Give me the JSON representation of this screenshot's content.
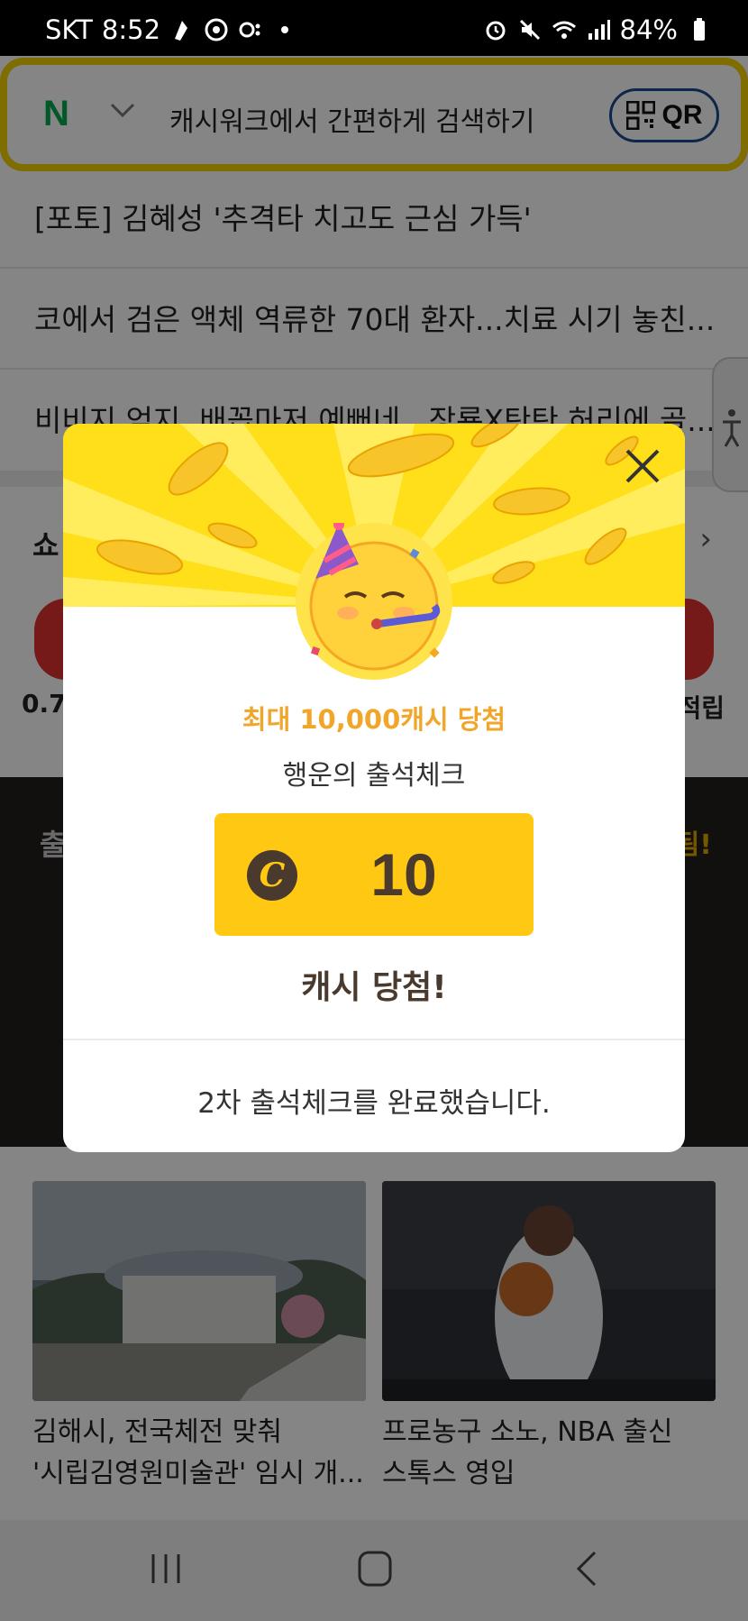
{
  "status_bar": {
    "carrier": "SKT",
    "time": "8:52",
    "battery": "84%"
  },
  "search": {
    "engine_logo": "N",
    "placeholder": "캐시워크에서 간편하게 검색하기",
    "qr_label": "QR"
  },
  "news": [
    "[포토] 김혜성 '추격타 치고도 근심 가득'",
    "코에서 검은 액체 역류한 70대 환자...치료 시기 놓친...",
    "비비지 엄지, 배꼽마저 예뻐네.. 장룡X탄탄 허리에 골..."
  ],
  "shopping": {
    "title": "쇼",
    "left_caption": "0.7",
    "right_caption": "적립"
  },
  "dark_banner": {
    "left": "출",
    "right": "됨!"
  },
  "cards": [
    {
      "title_line1": "김해시, 전국체전 맞춰",
      "title_line2": "'시립김영원미술관' 임시 개..."
    },
    {
      "title_line1": "프로농구 소노, NBA 출신",
      "title_line2": "스톡스 영입"
    }
  ],
  "popup": {
    "subhead": "최대 10,000캐시 당첨",
    "lead": "행운의 출석체크",
    "coin_symbol": "C",
    "prize_value": "10",
    "win_text": "캐시 당첨!",
    "footer": "2차 출석체크를 완료했습니다."
  },
  "colors": {
    "popup_yellow": "#ffdf1a",
    "prize_yellow": "#ffc913",
    "subhead_orange": "#f1a62a",
    "brown": "#4a3a2e",
    "search_border": "#f3d100"
  }
}
